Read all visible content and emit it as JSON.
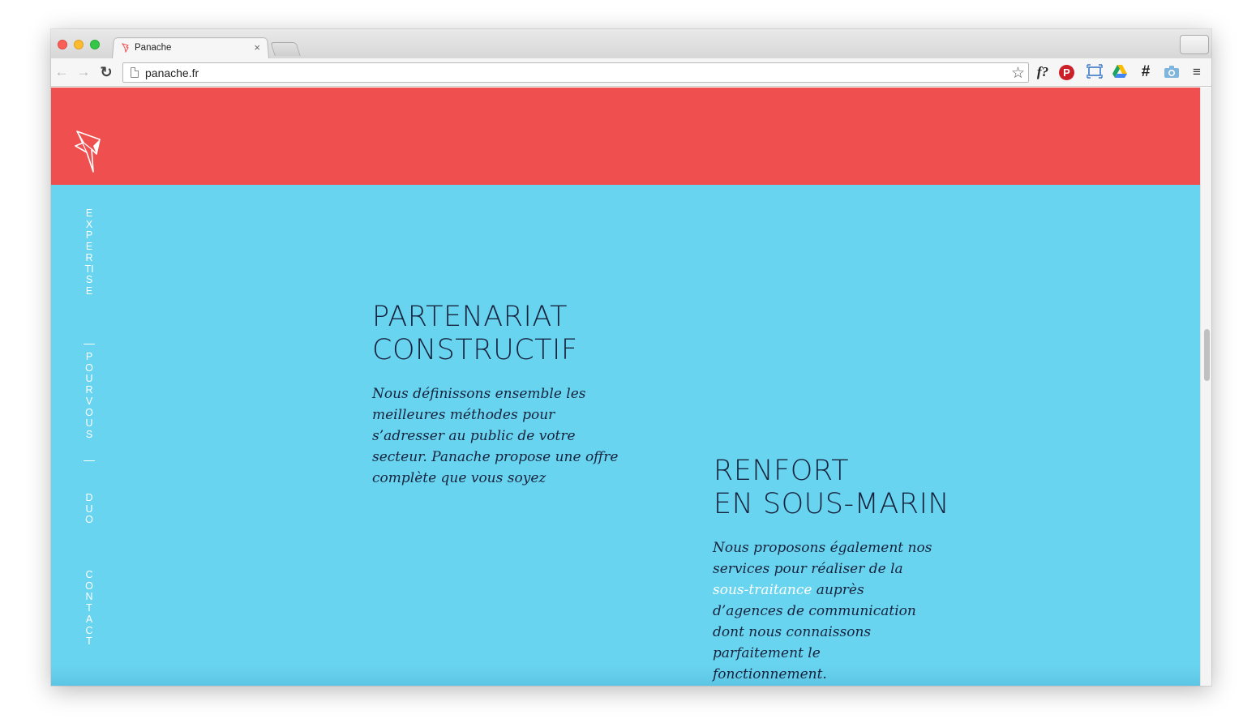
{
  "browser": {
    "tab_title": "Panache",
    "tab_close": "×",
    "url": "panache.fr",
    "extensions": {
      "fonts_label": "f?",
      "pinterest_label": "P",
      "hash_label": "#",
      "menu_label": "≡"
    }
  },
  "site": {
    "colors": {
      "header": "#f04f4f",
      "section": "#69d4f0",
      "text": "#17233d"
    },
    "sidenav": [
      {
        "label": "EXPERTISE"
      },
      {
        "label": "POUR VOUS"
      },
      {
        "label": "DUO"
      },
      {
        "label": "CONTACT"
      }
    ],
    "blocks": [
      {
        "title_line1": "PARTENARIAT",
        "title_line2": "CONSTRUCTIF",
        "text": "Nous définissons ensemble les meilleures méthodes pour s’adresser au public de votre secteur. Panache propose une offre complète que vous soyez"
      },
      {
        "title_line1": "RENFORT",
        "title_line2": "EN SOUS-MARIN",
        "text_before": "Nous proposons également nos services pour réaliser de la ",
        "link": "sous-traitance",
        "text_after": " auprès d’agences de communication dont nous connaissons parfaitement le fonctionnement."
      }
    ]
  }
}
